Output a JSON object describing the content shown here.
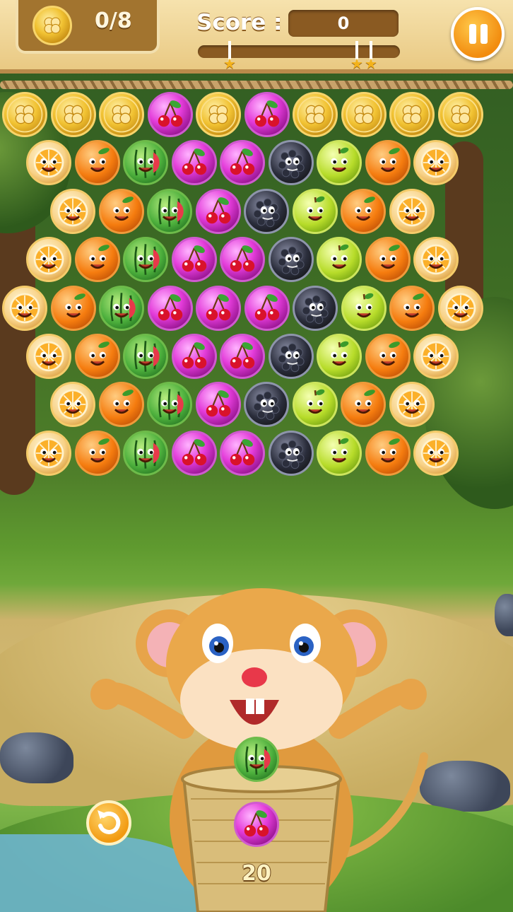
{
  "hud": {
    "coins_collected": "0/8",
    "score_label": "Score :",
    "score_value": "0",
    "score_progress": 0.0,
    "star_thresholds": [
      0.16,
      0.79,
      0.86
    ]
  },
  "colors": {
    "header_bg": "#efd49a",
    "panel_brown": "#a2742f",
    "pause_orange": "#f28c0f",
    "star_gold": "#f3b21a"
  },
  "bubble_grid": [
    [
      "coin",
      "coin",
      "coin",
      "cherry",
      "coin",
      "cherry",
      "coin",
      "coin",
      "coin",
      "coin"
    ],
    [
      "orange-slice",
      "orange",
      "watermelon",
      "cherry",
      "cherry",
      "blackberry",
      "apple",
      "orange",
      "orange-slice"
    ],
    [
      "orange-slice",
      "orange",
      "watermelon",
      "cherry",
      "blackberry",
      "apple",
      "orange",
      "orange-slice"
    ],
    [
      "orange-slice",
      "orange",
      "watermelon",
      "cherry",
      "cherry",
      "blackberry",
      "apple",
      "orange",
      "orange-slice"
    ],
    [
      "orange-slice",
      "orange",
      "watermelon",
      "cherry",
      "cherry",
      "cherry",
      "blackberry",
      "apple",
      "orange",
      "orange-slice"
    ],
    [
      "orange-slice",
      "orange",
      "watermelon",
      "cherry",
      "cherry",
      "blackberry",
      "apple",
      "orange",
      "orange-slice"
    ],
    [
      "orange-slice",
      "orange",
      "watermelon",
      "cherry",
      "blackberry",
      "apple",
      "orange",
      "orange-slice"
    ],
    [
      "orange-slice",
      "orange",
      "watermelon",
      "cherry",
      "cherry",
      "blackberry",
      "apple",
      "orange",
      "orange-slice"
    ]
  ],
  "shooter": {
    "current_bubble": "watermelon",
    "next_bubble": "cherry",
    "shots_left": "20"
  },
  "icons": {
    "pause": "pause-icon",
    "restart": "swap-icon",
    "coin": "clover-coin-icon"
  }
}
